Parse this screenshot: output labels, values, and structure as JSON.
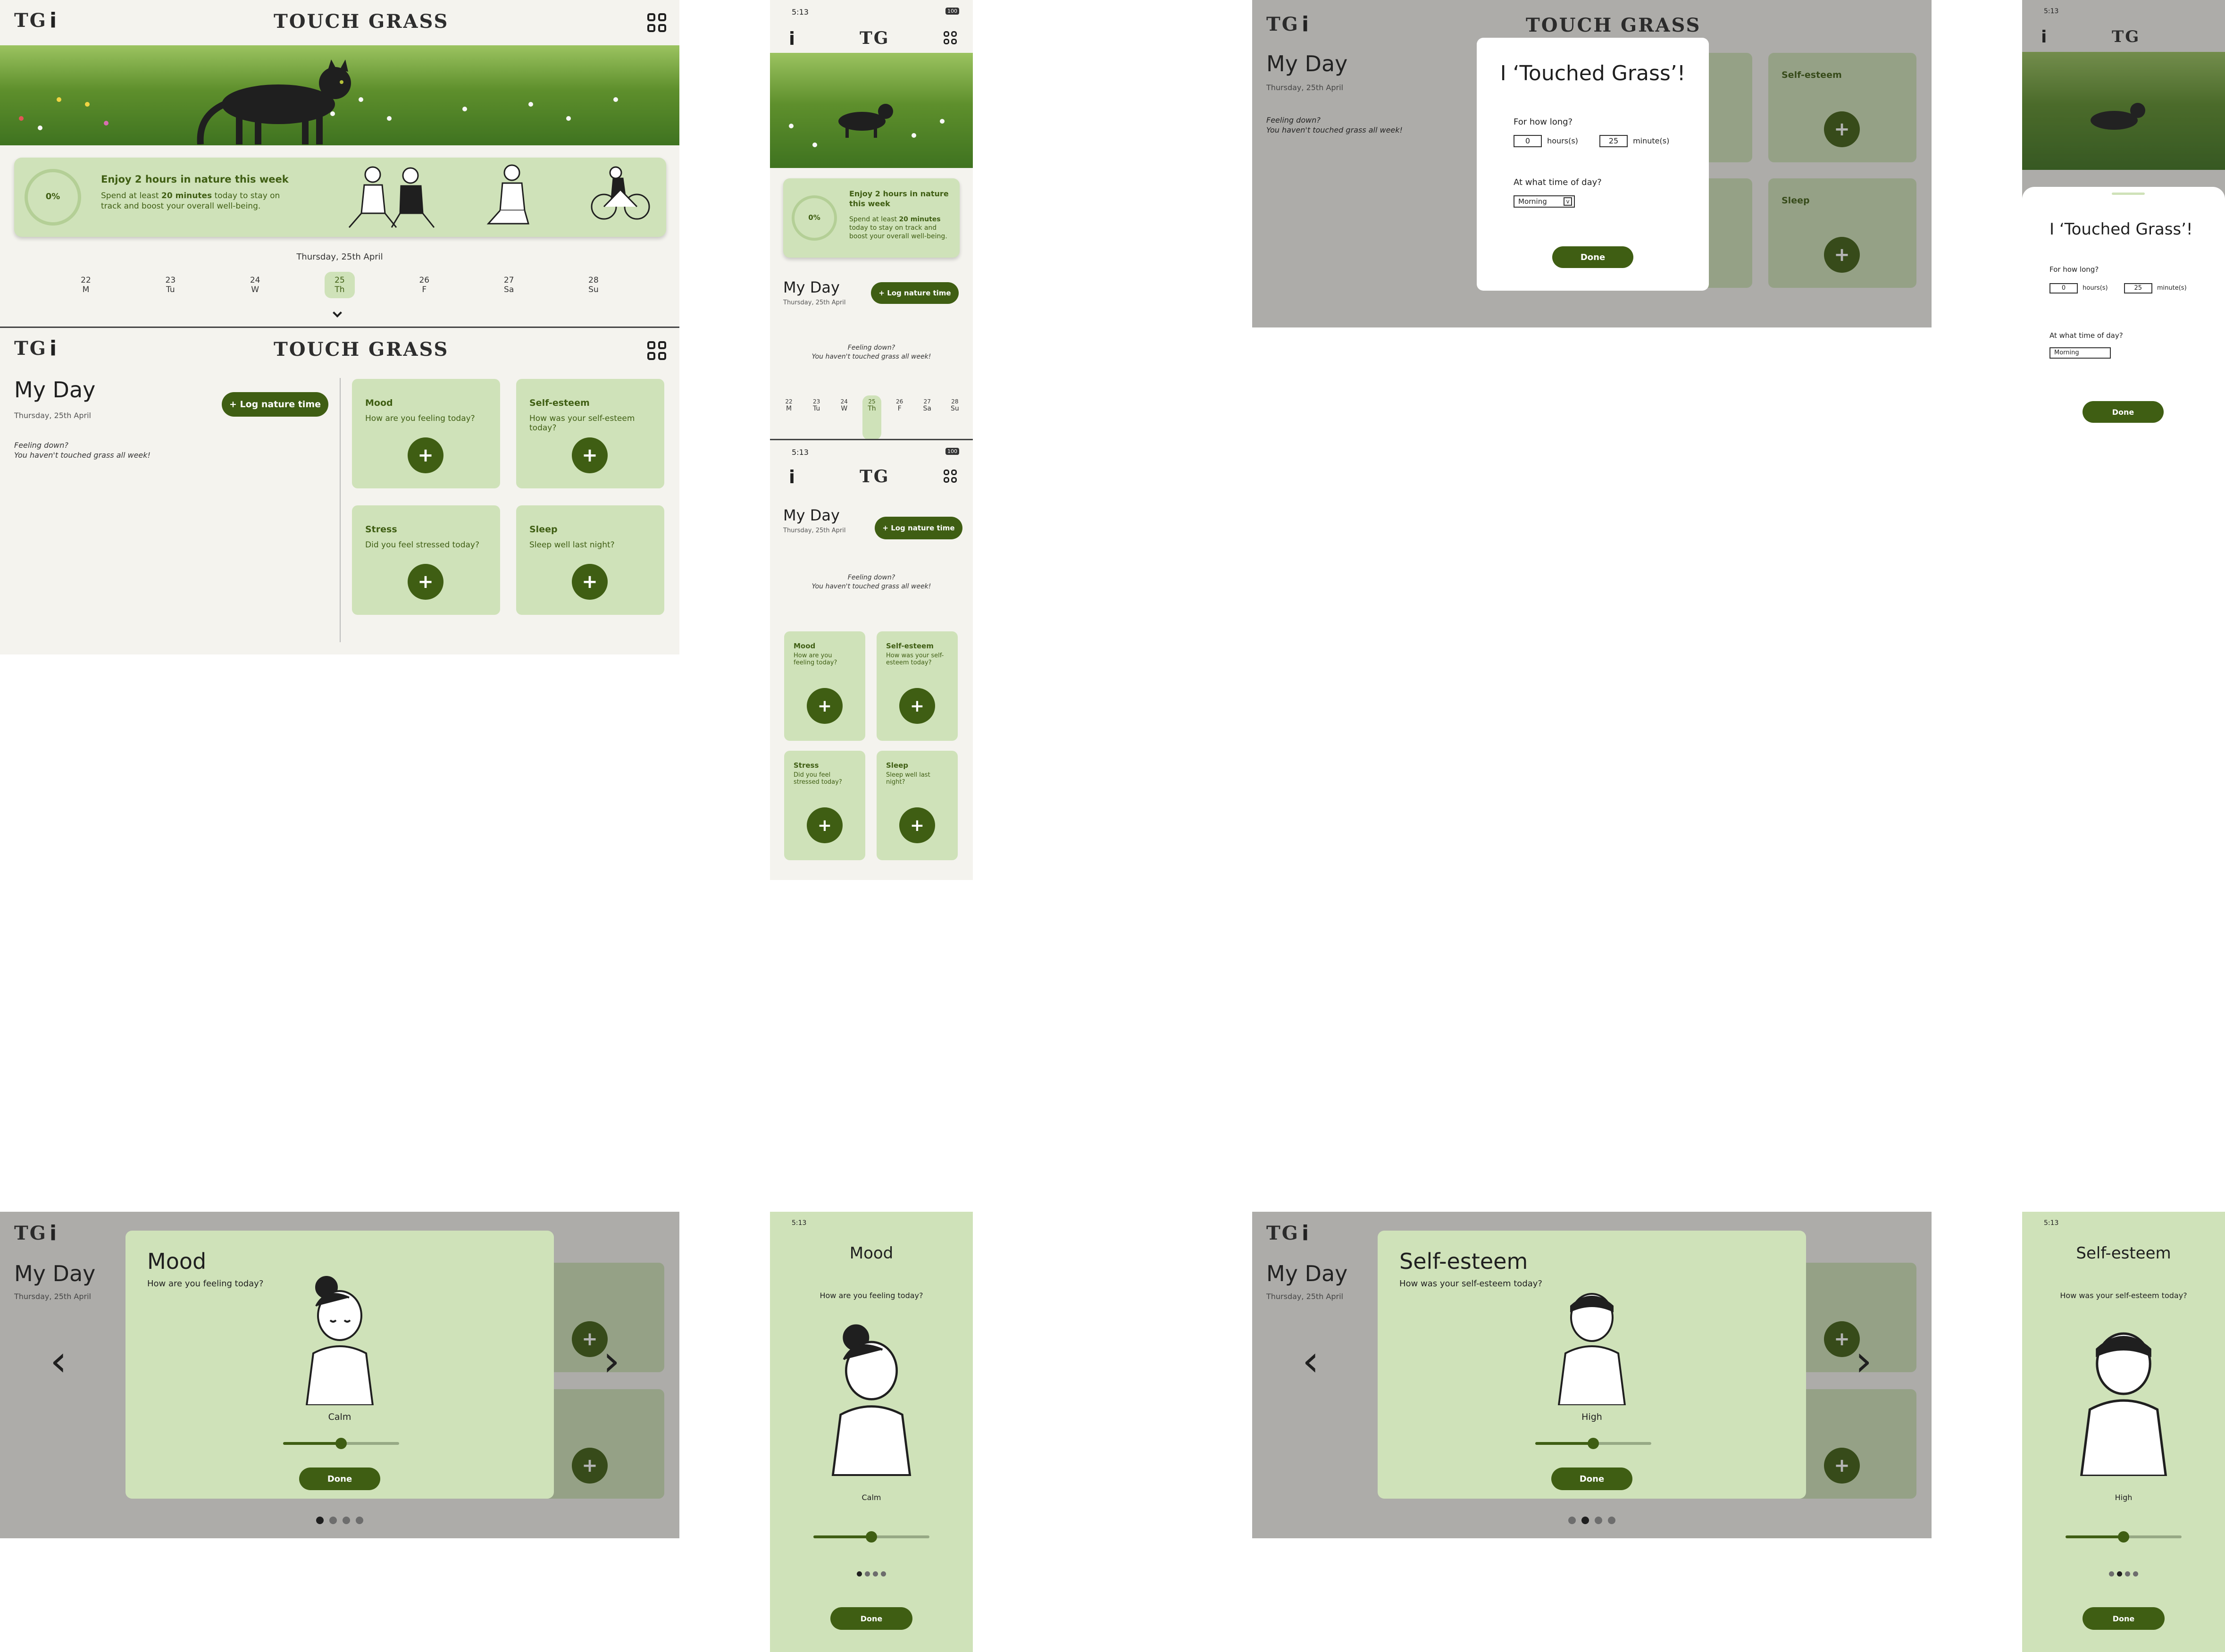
{
  "app": {
    "logo": "TOUCH GRASS",
    "logo_short": "TG",
    "info": "i",
    "status_time": "5:13",
    "battery": "100"
  },
  "progress": {
    "percent_label": "0%",
    "percent": 0,
    "goal_title": "Enjoy 2 hours in nature this week",
    "goal_line1": "Spend at least ",
    "goal_bold": "20 minutes",
    "goal_line2": " today to stay on track and boost your overall well-being.",
    "goal_line2_short": " today to stay on track and boost your overall well-being."
  },
  "date_label": "Thursday, 25th April",
  "week": [
    {
      "num": "22",
      "day": "M"
    },
    {
      "num": "23",
      "day": "Tu"
    },
    {
      "num": "24",
      "day": "W"
    },
    {
      "num": "25",
      "day": "Th"
    },
    {
      "num": "26",
      "day": "F"
    },
    {
      "num": "27",
      "day": "Sa"
    },
    {
      "num": "28",
      "day": "Su"
    }
  ],
  "myday": {
    "title": "My Day",
    "date": "Thursday, 25th April",
    "log_button": "+ Log nature time",
    "feeling_line1": "Feeling down?",
    "feeling_line2": "You haven't touched grass all week!"
  },
  "cards": {
    "mood": {
      "title": "Mood",
      "question": "How are you feeling today?"
    },
    "esteem": {
      "title": "Self-esteem",
      "question": "How was your self-esteem today?"
    },
    "stress": {
      "title": "Stress",
      "question": "Did you feel stressed today?"
    },
    "sleep": {
      "title": "Sleep",
      "question": "Sleep well last night?"
    },
    "plus": "+"
  },
  "log_modal": {
    "title": "I ‘Touched Grass’!",
    "how_long": "For how long?",
    "hours_value": "0",
    "hours_label": "hours(s)",
    "minutes_value": "25",
    "minutes_label": "minute(s)",
    "time_of_day": "At what time of day?",
    "time_value": "Morning",
    "done": "Done"
  },
  "mood_modal": {
    "title": "Mood",
    "question": "How are you feeling today?",
    "value_label": "Calm",
    "level": 0.5,
    "done": "Done"
  },
  "esteem_modal": {
    "title": "Self-esteem",
    "question": "How was your self-esteem today?",
    "value_label": "High",
    "level": 0.5,
    "done": "Done"
  },
  "nav": {
    "prev": "‹",
    "next": "›"
  },
  "colors": {
    "accent": "#3f5e13",
    "card": "#cfe2b9",
    "page": "#f4f3ee"
  }
}
